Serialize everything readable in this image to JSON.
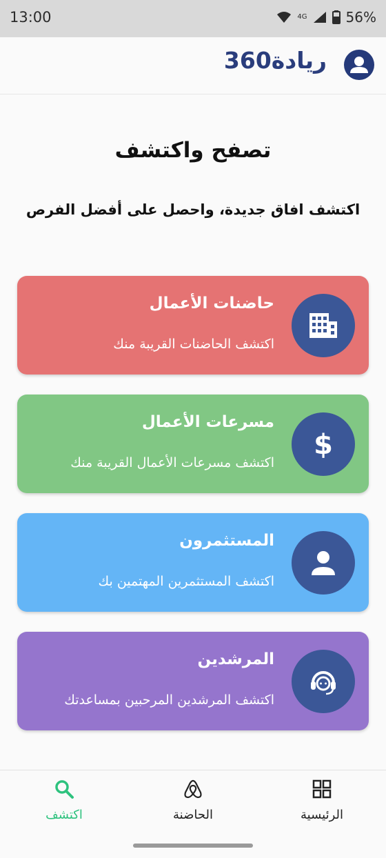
{
  "status": {
    "time": "13:00",
    "network": "4G",
    "battery": "56%"
  },
  "appbar": {
    "brand_text": "ريادة",
    "brand_number": "360",
    "avatar_icon": "person-icon"
  },
  "page": {
    "title": "تصفح واكتشف",
    "subtitle": "اكتشف افاق جديدة، واحصل على أفضل الفرص"
  },
  "cards": [
    {
      "title": "حاضنات الأعمال",
      "description": "اكتشف الحاضنات القريبة منك",
      "icon": "building-icon",
      "color": "#e57373"
    },
    {
      "title": "مسرعات الأعمال",
      "description": "اكتشف مسرعات الأعمال القريبة منك",
      "icon": "dollar-icon",
      "color": "#81c784"
    },
    {
      "title": "المستثمرون",
      "description": "اكتشف المستثمرين المهتمين بك",
      "icon": "person-icon",
      "color": "#64b5f6"
    },
    {
      "title": "المرشدين",
      "description": "اكتشف المرشدين المرحبين بمساعدتك",
      "icon": "headset-icon",
      "color": "#9575cd"
    }
  ],
  "bottom_nav": [
    {
      "label": "اكتشف",
      "icon": "search-icon",
      "active": true
    },
    {
      "label": "الحاضنة",
      "icon": "airbnb-icon",
      "active": false
    },
    {
      "label": "الرئيسية",
      "icon": "dashboard-icon",
      "active": false
    }
  ],
  "colors": {
    "accent": "#2ec27e",
    "brand": "#2a3d7c",
    "icon_circle": "#3b5797"
  }
}
